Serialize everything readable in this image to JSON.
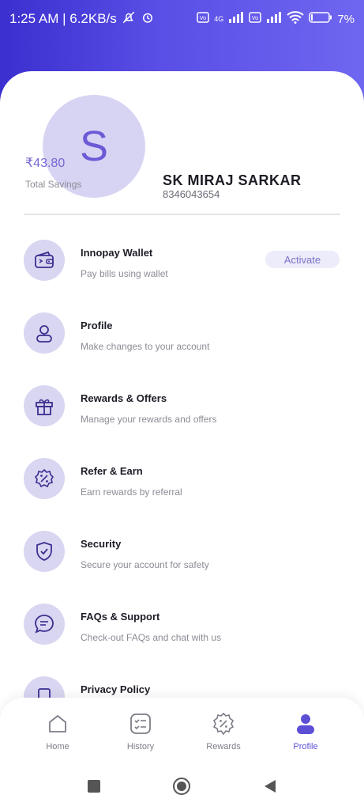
{
  "status_bar": {
    "time_speed": "1:25 AM | 6.2KB/s",
    "battery": "7%",
    "net1": "4G"
  },
  "profile": {
    "avatar_letter": "S",
    "name": "SK MIRAJ SARKAR",
    "phone": "8346043654"
  },
  "savings": {
    "amount": "₹43.80",
    "label": "Total Savings"
  },
  "menu": [
    {
      "title": "Innopay Wallet",
      "subtitle": "Pay bills using wallet",
      "icon": "wallet-icon",
      "action": "Activate"
    },
    {
      "title": "Profile",
      "subtitle": "Make changes to your account",
      "icon": "user-icon"
    },
    {
      "title": "Rewards & Offers",
      "subtitle": "Manage your rewards and offers",
      "icon": "gift-icon"
    },
    {
      "title": "Refer & Earn",
      "subtitle": "Earn rewards by referral",
      "icon": "percent-badge-icon"
    },
    {
      "title": "Security",
      "subtitle": "Secure your account for safety",
      "icon": "shield-icon"
    },
    {
      "title": "FAQs & Support",
      "subtitle": "Check-out FAQs and chat with us",
      "icon": "chat-icon"
    },
    {
      "title": "Privacy Policy",
      "subtitle": "",
      "icon": "document-icon"
    }
  ],
  "bottom_nav": [
    {
      "label": "Home",
      "icon": "home-icon",
      "active": false
    },
    {
      "label": "History",
      "icon": "history-icon",
      "active": false
    },
    {
      "label": "Rewards",
      "icon": "rewards-icon",
      "active": false
    },
    {
      "label": "Profile",
      "icon": "profile-icon",
      "active": true
    }
  ],
  "colors": {
    "accent": "#5c4fd6",
    "header_gradient_start": "#3b2fcf",
    "header_gradient_end": "#6f66f0",
    "icon_circle": "#d9d6f2"
  }
}
